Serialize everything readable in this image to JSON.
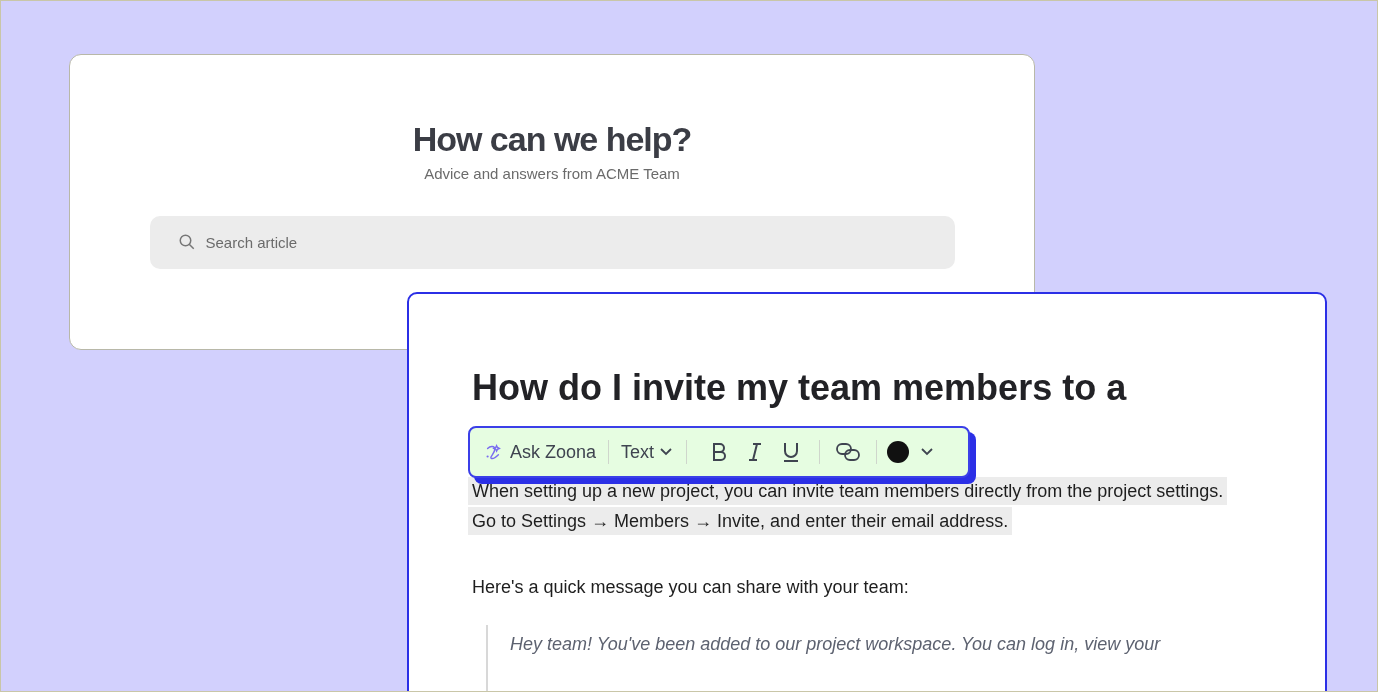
{
  "help_card": {
    "title": "How can we help?",
    "subtitle": "Advice and answers from ACME Team",
    "search": {
      "placeholder": "Search article"
    }
  },
  "article": {
    "title": "How do I invite my team members to a",
    "toolbar": {
      "ask_label": "Ask Zoona",
      "style_label": "Text",
      "color": "#111111"
    },
    "highlighted_paragraph": "When setting up a new project, you can invite team members directly from the project settings. Go to Settings → Members → Invite, and enter their email address.",
    "paragraph": "Here's a quick message you can share with your team:",
    "quote": "Hey team! You've been added to our project workspace. You can log in, view your"
  }
}
